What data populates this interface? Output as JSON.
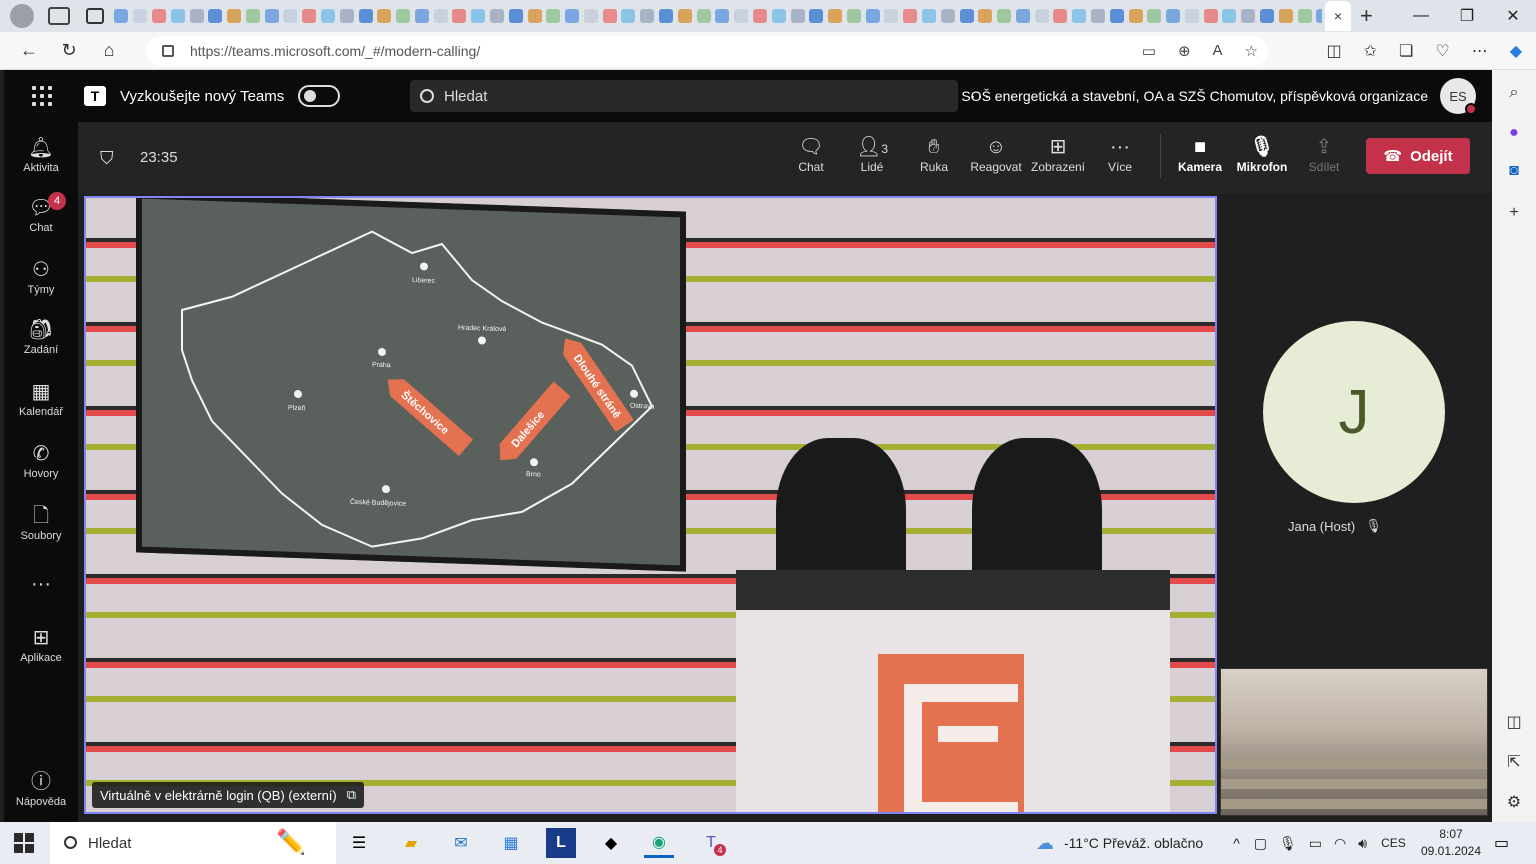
{
  "browser": {
    "active_tab_close": "×",
    "new_tab": "+",
    "url": "https://teams.microsoft.com/_#/modern-calling/",
    "window_controls": {
      "minimize": "—",
      "restore": "❐",
      "close": "✕"
    }
  },
  "teams_header": {
    "try_new_label": "Vyzkoušejte nový Teams",
    "search_placeholder": "Hledat",
    "more": "···",
    "organization": "SOŠ energetická a stavební, OA a SZŠ Chomutov, příspěvková organizace",
    "avatar_initials": "ES"
  },
  "rail": {
    "items": [
      {
        "label": "Aktivita",
        "icon": "bell-icon"
      },
      {
        "label": "Chat",
        "icon": "chat-icon",
        "badge": "4"
      },
      {
        "label": "Týmy",
        "icon": "teams-icon"
      },
      {
        "label": "Zadání",
        "icon": "assignments-icon"
      },
      {
        "label": "Kalendář",
        "icon": "calendar-icon"
      },
      {
        "label": "Hovory",
        "icon": "phone-icon"
      },
      {
        "label": "Soubory",
        "icon": "file-icon"
      },
      {
        "label": "···",
        "icon": "more-icon"
      },
      {
        "label": "Aplikace",
        "icon": "apps-icon"
      },
      {
        "label": "Nápověda",
        "icon": "help-icon"
      }
    ]
  },
  "call": {
    "timer": "23:35",
    "buttons": {
      "chat": "Chat",
      "people": "Lidé",
      "people_count": "3",
      "hand": "Ruka",
      "react": "Reagovat",
      "view": "Zobrazení",
      "more": "Více",
      "camera": "Kamera",
      "mic": "Mikrofon",
      "share": "Sdílet"
    },
    "leave_label": "Odejít",
    "main_video_label": "Virtuálně v elektrárně login (QB) (externí)",
    "participant_initial": "J",
    "participant_name": "Jana (Host)"
  },
  "map": {
    "cities": [
      "Liberec",
      "Hradec Králové",
      "Praha",
      "Plzeň",
      "Ostrava",
      "Brno",
      "České Budějovice"
    ],
    "arrows": [
      "Štěchovice",
      "Dalešice",
      "Dlouhé stráně"
    ]
  },
  "taskbar": {
    "search_placeholder": "Hledat",
    "teams_badge": "4",
    "weather": "-11°C  Převáž. oblačno",
    "language": "CES",
    "time": "8:07",
    "date": "09.01.2024"
  },
  "colors": {
    "leave": "#c4314b",
    "active_border": "#7f85f5",
    "teams_bg": "#0b0b0b"
  }
}
